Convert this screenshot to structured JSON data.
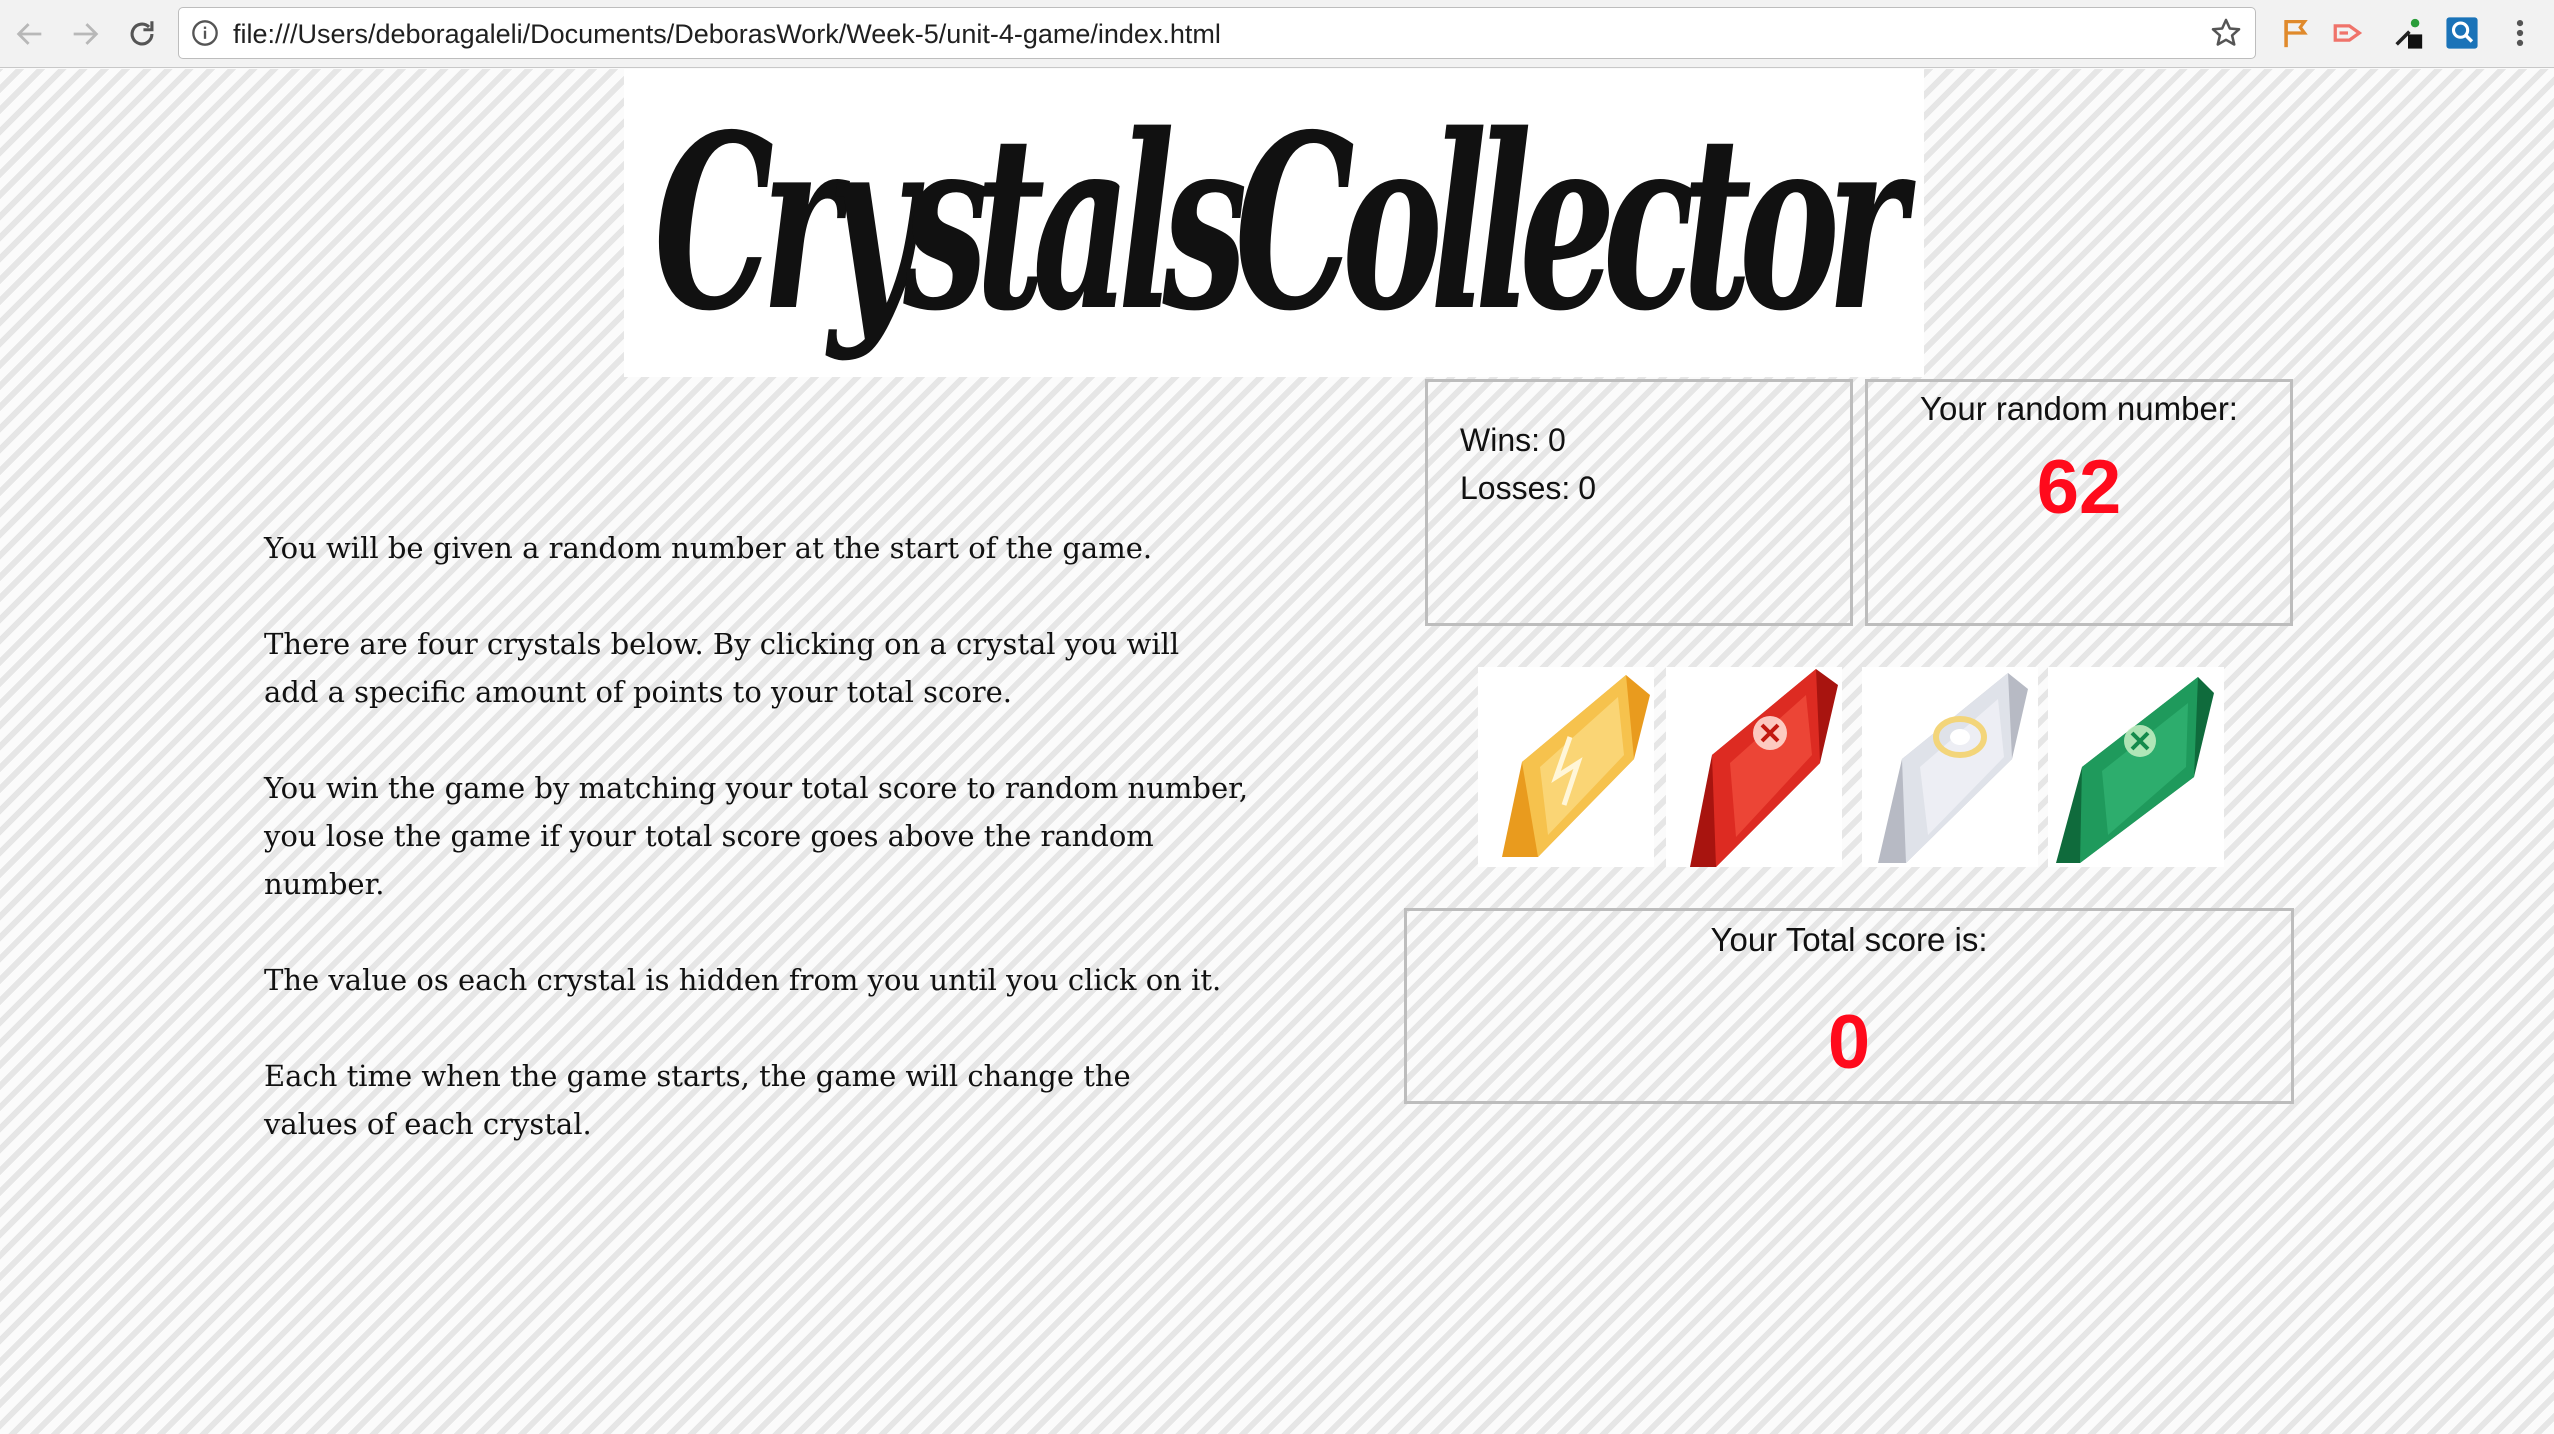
{
  "browser": {
    "url": "file:///Users/deboragaleli/Documents/DeborasWork/Week-5/unit-4-game/index.html",
    "icons": [
      "back-arrow-icon",
      "forward-arrow-icon",
      "reload-icon",
      "info-icon",
      "bookmark-star-icon",
      "extension-icons",
      "menu-dots-icon"
    ]
  },
  "page": {
    "banner_title": "CrystalsCollector",
    "instructions": [
      "You will be given a random number at the start of the game.",
      "There are four crystals below. By clicking on a crystal you will add a specific amount of points to your total score.",
      "You win the game by matching your total score to random number, you lose the game if your total score goes above the random number.",
      "The value os each crystal is hidden from you until you click on it.",
      "Each time when the game starts, the game will change the values of each crystal."
    ],
    "stats": {
      "wins_label": "Wins:",
      "wins": "0",
      "losses_label": "Losses:",
      "losses": "0"
    },
    "random": {
      "label": "Your random number:",
      "value": "62"
    },
    "crystals": [
      {
        "name": "yellow crystal",
        "color": "#f2b53a"
      },
      {
        "name": "red crystal",
        "color": "#d42a22"
      },
      {
        "name": "white crystal",
        "color": "#d8dbe2"
      },
      {
        "name": "green crystal",
        "color": "#1f8a55"
      }
    ],
    "score": {
      "label": "Your Total score is:",
      "value": "0"
    },
    "accent_color": "#ff0a1c"
  }
}
